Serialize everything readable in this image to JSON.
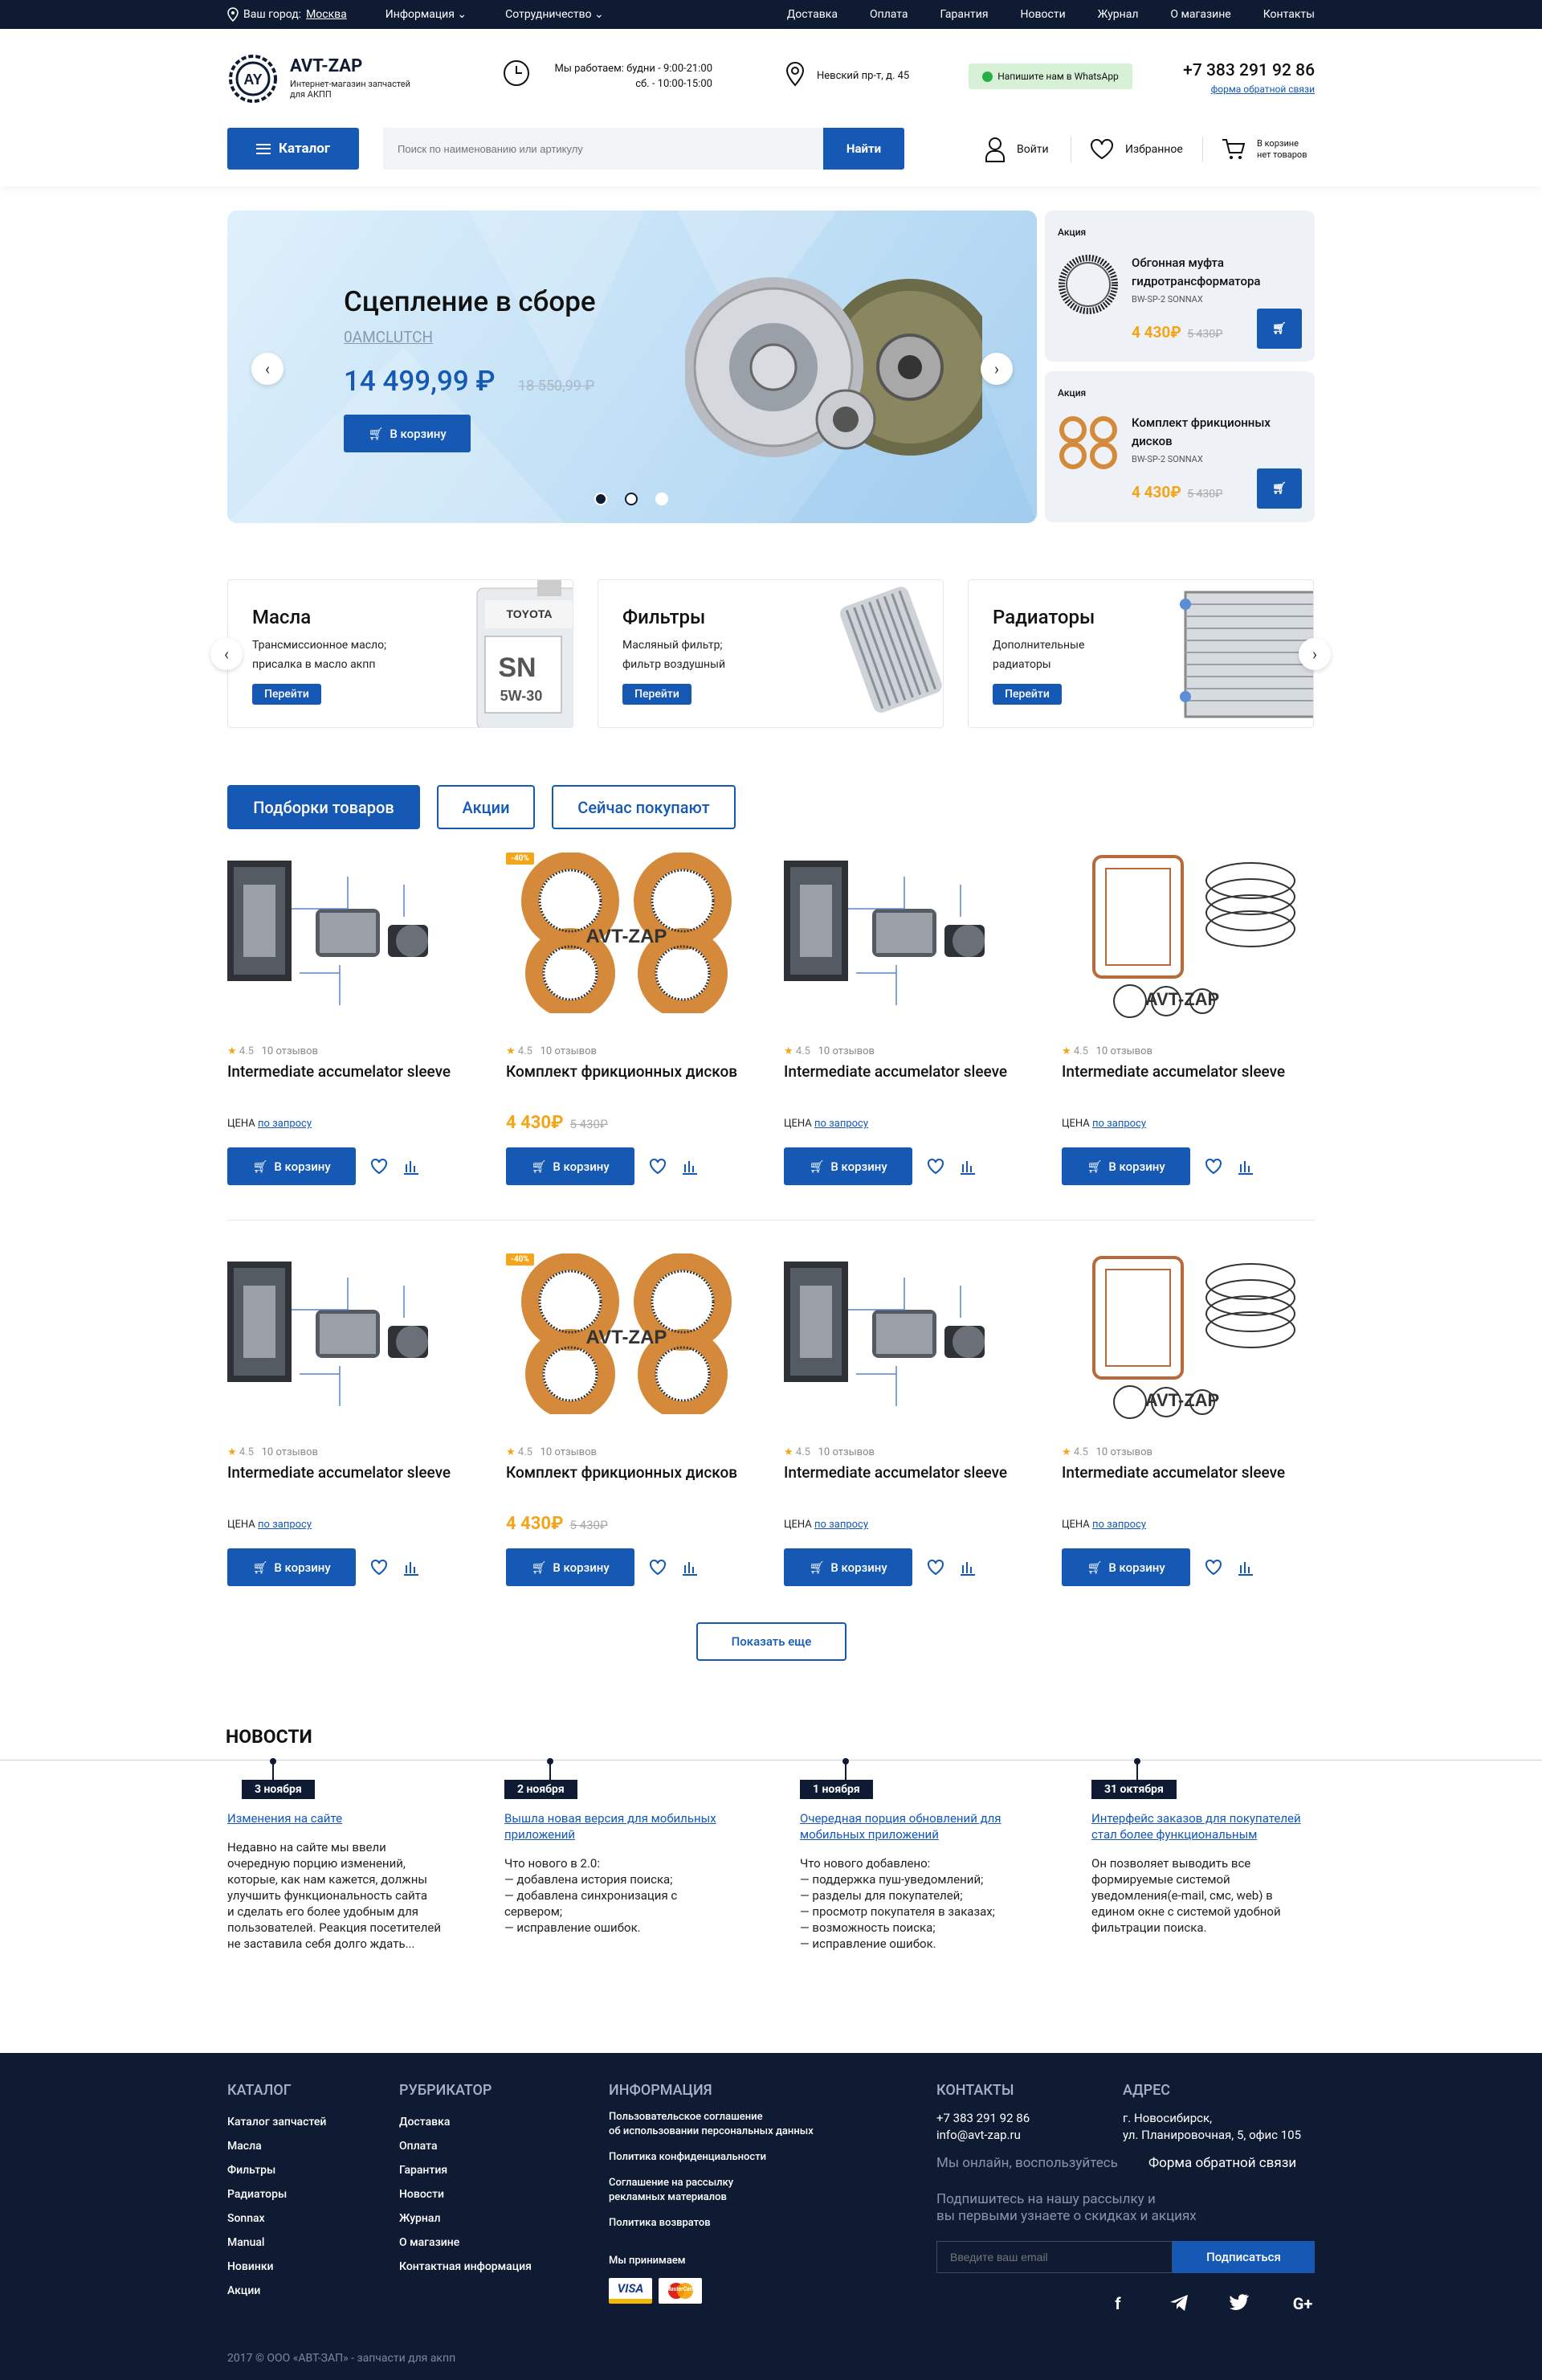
{
  "topbar": {
    "city_label": "Ваш город:",
    "city_value": "Москва",
    "info": "Информация",
    "coop": "Сотрудничество",
    "nav": [
      "Доставка",
      "Оплата",
      "Гарантия",
      "Новости",
      "Журнал",
      "О магазине",
      "Контакты"
    ]
  },
  "header": {
    "brand": "AVT-ZAP",
    "tagline": "Интернет-магазин запчастей для АКПП",
    "hours_title": "Мы работаем: будни - 9:00-21:00",
    "hours_weekend": "сб. - 10:00-15:00",
    "address": "Невский пр-т, д. 45",
    "whatsapp": "Напишите нам в WhatsApp",
    "phone": "+7 383 291 92 86",
    "feedback": "форма обратной связи",
    "catalog_btn": "Каталог",
    "search_placeholder": "Поиск по наименованию или артикулу",
    "search_btn": "Найти",
    "login": "Войти",
    "favorites": "Избранное",
    "cart_title": "В корзине",
    "cart_status": "нет товаров"
  },
  "hero": {
    "title": "Сцепление в сборе",
    "sku": "0AMCLUTCH",
    "price": "14 499,99 ₽",
    "old_price": "18 550,99 ₽",
    "cart_btn": "В корзину",
    "slides": 3,
    "active_slide": 1
  },
  "promo": [
    {
      "tag": "Акция",
      "name": "Обгонная муфта гидротрансформатора",
      "sku": "BW-SP-2 SONNAX",
      "price": "4 430₽",
      "old": "5 430₽"
    },
    {
      "tag": "Акция",
      "name": "Комплект фрикционных дисков",
      "sku": "BW-SP-2 SONNAX",
      "price": "4 430₽",
      "old": "5 430₽"
    }
  ],
  "categories": [
    {
      "title": "Масла",
      "desc": "Трансмиссионное масло;\nприсалка в масло акпп",
      "btn": "Перейти"
    },
    {
      "title": "Фильтры",
      "desc": "Масляный фильтр;\nфильтр воздушный",
      "btn": "Перейти"
    },
    {
      "title": "Радиаторы",
      "desc": "Дополнительные\nрадиаторы",
      "btn": "Перейти"
    }
  ],
  "tabs": [
    "Подборки товаров",
    "Акции",
    "Сейчас покупают"
  ],
  "products": [
    {
      "type": "sleeve",
      "rating": "4.5",
      "reviews": "10 отзывов",
      "name": "Intermediate accumelator sleeve",
      "price_label": "ЦЕНА",
      "price_link": "по запросу",
      "cart": "В корзину"
    },
    {
      "type": "discs",
      "badge": "-40%",
      "rating": "4.5",
      "reviews": "10 отзывов",
      "name": "Комплект фрикционных дисков",
      "price": "4 430₽",
      "old": "5 430₽",
      "cart": "В корзину"
    },
    {
      "type": "sleeve",
      "rating": "4.5",
      "reviews": "10 отзывов",
      "name": "Intermediate accumelator sleeve",
      "price_label": "ЦЕНА",
      "price_link": "по запросу",
      "cart": "В корзину"
    },
    {
      "type": "gasket",
      "rating": "4.5",
      "reviews": "10 отзывов",
      "name": "Intermediate accumelator sleeve",
      "price_label": "ЦЕНА",
      "price_link": "по запросу",
      "cart": "В корзину"
    },
    {
      "type": "sleeve",
      "rating": "4.5",
      "reviews": "10 отзывов",
      "name": "Intermediate accumelator sleeve",
      "price_label": "ЦЕНА",
      "price_link": "по запросу",
      "cart": "В корзину"
    },
    {
      "type": "discs",
      "badge": "-40%",
      "rating": "4.5",
      "reviews": "10 отзывов",
      "name": "Комплект фрикционных дисков",
      "price": "4 430₽",
      "old": "5 430₽",
      "cart": "В корзину"
    },
    {
      "type": "sleeve",
      "rating": "4.5",
      "reviews": "10 отзывов",
      "name": "Intermediate accumelator sleeve",
      "price_label": "ЦЕНА",
      "price_link": "по запросу",
      "cart": "В корзину"
    },
    {
      "type": "gasket",
      "rating": "4.5",
      "reviews": "10 отзывов",
      "name": "Intermediate accumelator sleeve",
      "price_label": "ЦЕНА",
      "price_link": "по запросу",
      "cart": "В корзину"
    }
  ],
  "show_more": "Показать еще",
  "news_title": "НОВОСТИ",
  "news": [
    {
      "date": "3 ноября",
      "title": "Изменения на сайте",
      "text": "Недавно на сайте мы ввели\nочередную порцию изменений,\nкоторые, как нам кажется, должны\nулучшить функциональность сайта\nи сделать его более удобным для\nпользователей. Реакция посетителей\nне заставила себя долго ждать..."
    },
    {
      "date": "2 ноября",
      "title": "Вышла новая версия для мобильных приложений",
      "text": "Что нового в 2.0:\n— добавлена история поиска;\n— добавлена синхронизация с сервером;\n— исправление ошибок."
    },
    {
      "date": "1 ноября",
      "title": "Очередная порция обновлений для мобильных приложений",
      "text": "Что нового добавлено:\n— поддержка пуш-уведомлений;\n— разделы для покупателей;\n— просмотр покупателя в заказах;\n— возможность поиска;\n— исправление ошибок."
    },
    {
      "date": "31 октября",
      "title": "Интерфейс заказов для покупателей стал более функциональным",
      "text": "Он позволяет выводить все\nформируемые системой\nуведомления(e-mail, смс, web) в\nедином окне с системой удобной\nфильтрации поиска."
    }
  ],
  "footer": {
    "catalog_title": "КАТАЛОГ",
    "catalog": [
      "Каталог запчастей",
      "Масла",
      "Фильтры",
      "Радиаторы",
      "Sonnax",
      "Manual",
      "Новинки",
      "Акции"
    ],
    "rubric_title": "РУБРИКАТОР",
    "rubric": [
      "Доставка",
      "Оплата",
      "Гарантия",
      "Новости",
      "Журнал",
      "О магазине",
      "Контактная информация"
    ],
    "info_title": "ИНФОРМАЦИЯ",
    "info": [
      "Пользовательское соглашение\nоб использовании персональных данных",
      "Политика конфиденциальности",
      "Соглашение на рассылку\nрекламных материалов",
      "Политика возвратов"
    ],
    "accept": "Мы принимаем",
    "visa": "VISA",
    "mastercard": "MasterCard",
    "contacts_title": "КОНТАКТЫ",
    "phone": "+7 383 291 92 86",
    "email": "info@avt-zap.ru",
    "address_title": "АДРЕС",
    "address": "г. Новосибирск,\nул. Планировочная, 5, офис 105",
    "online": "Мы онлайн, воспользуйтесь",
    "feedback_form": "Форма обратной связи",
    "subscribe_text": "Подпишитесь на нашу рассылку и\nвы первыми узнаете о скидках и акциях",
    "email_placeholder": "Введите ваш email",
    "subscribe_btn": "Подписаться",
    "copyright": "2017 © ООО «АВТ-ЗАП» - запчасти для акпп"
  },
  "colors": {
    "accent": "#1559b4",
    "dark": "#0e1b33",
    "orange": "#f3a517"
  }
}
